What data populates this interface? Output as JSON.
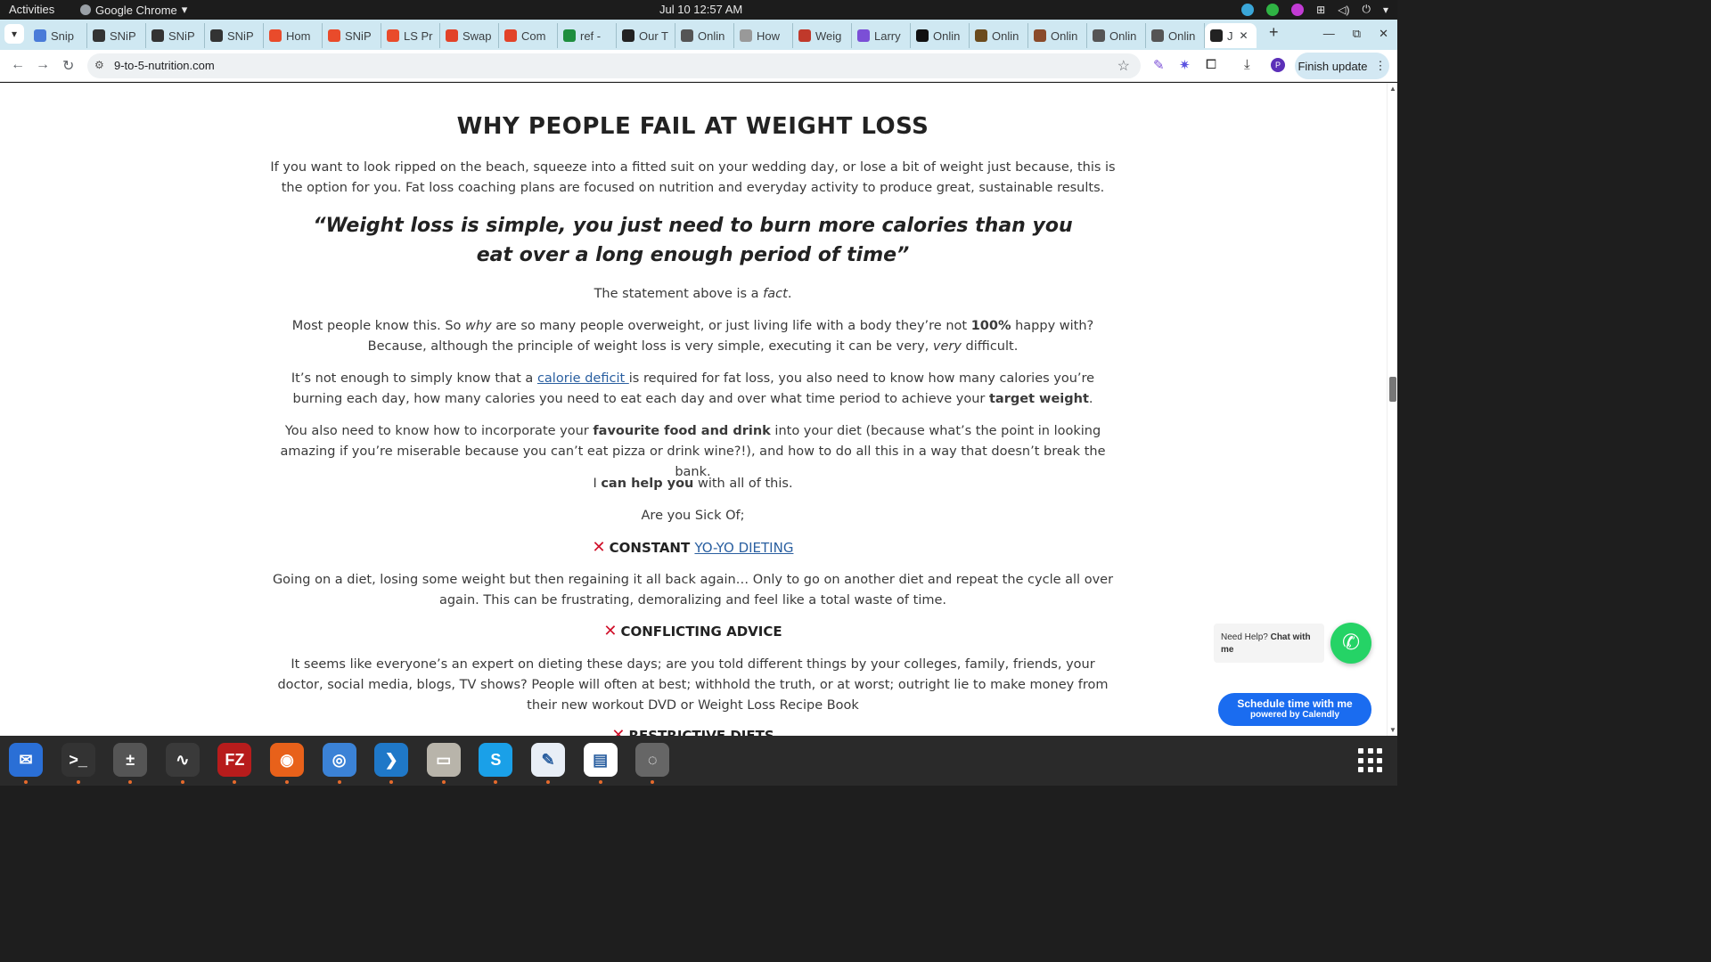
{
  "topbar": {
    "activities": "Activities",
    "app_name": "Google Chrome",
    "clock": "Jul 10  12:57 AM"
  },
  "tabs": [
    {
      "label": "Snip",
      "color": "#4a7bd8"
    },
    {
      "label": "SNiP",
      "color": "#333333"
    },
    {
      "label": "SNiP",
      "color": "#333333"
    },
    {
      "label": "SNiP",
      "color": "#333333"
    },
    {
      "label": "Hom",
      "color": "#e94b2b"
    },
    {
      "label": "SNiP",
      "color": "#e94b2b"
    },
    {
      "label": "LS Pr",
      "color": "#e94b2b"
    },
    {
      "label": "Swap",
      "color": "#e24329"
    },
    {
      "label": "Com",
      "color": "#e24329"
    },
    {
      "label": "ref -",
      "color": "#1e8e3e"
    },
    {
      "label": "Our T",
      "color": "#222222"
    },
    {
      "label": "Onlin",
      "color": "#555555"
    },
    {
      "label": "How",
      "color": "#999999"
    },
    {
      "label": "Weig",
      "color": "#c0392b"
    },
    {
      "label": "Larry",
      "color": "#7b4fd6"
    },
    {
      "label": "Onlin",
      "color": "#111111"
    },
    {
      "label": "Onlin",
      "color": "#6b4b1e"
    },
    {
      "label": "Onlin",
      "color": "#8a4b2b"
    },
    {
      "label": "Onlin",
      "color": "#555555"
    },
    {
      "label": "Onlin",
      "color": "#555555"
    }
  ],
  "active_tab": {
    "label": "J"
  },
  "address": {
    "url": "9-to-5-nutrition.com",
    "profile_initial": "P",
    "finish_update": "Finish update"
  },
  "article": {
    "title": "WHY PEOPLE FAIL AT WEIGHT LOSS",
    "intro": "If you want to look ripped on the beach, squeeze into a fitted suit on your wedding day, or lose a bit of weight just because, this is the option for you. Fat loss coaching plans are focused on nutrition and everyday activity to produce great, sustainable results.",
    "quote": "“Weight loss is simple, you just need to burn more calories than you eat over a long enough period of time”",
    "fact_prefix": "The statement above is a ",
    "fact_word": "fact",
    "fact_suffix": ".",
    "p2_a": "Most people know this. So ",
    "p2_b": "why",
    "p2_c": " are so many people overweight, or just living life with a body they’re not ",
    "p2_d": "100%",
    "p2_e": " happy with? Because, although the principle of weight loss is very simple, executing it can be very, ",
    "p2_f": "very",
    "p2_g": " difficult.",
    "p3_a": "It’s not enough to simply know that a ",
    "p3_link": "calorie deficit ",
    "p3_b": "is required for fat loss, you also need to know how many calories you’re burning each day, how many calories you need to eat each day and over what time period to achieve your ",
    "p3_c": "target weight",
    "p3_d": ".",
    "p4_a": "You also need to know how to incorporate your ",
    "p4_b": "favourite food and drink",
    "p4_c": " into your diet (because what’s the point in looking amazing if you’re miserable because you can’t eat pizza or drink wine?!), and how to do all this in a way that doesn’t break the bank.",
    "p5_a": "I ",
    "p5_b": "can help you",
    "p5_c": " with all of this.",
    "sick_of": "Are you Sick Of;",
    "h_yoyo_a": "CONSTANT ",
    "h_yoyo_link": "YO-YO DIETING",
    "yoyo_text": "Going on a diet, losing some weight but then regaining it all back again… Only to go on another diet and repeat the cycle all over again. This can be frustrating, demoralizing and feel like a total waste of time.",
    "h_conflict": "CONFLICTING ADVICE",
    "conflict_text": "It seems like everyone’s an expert on dieting these days; are you told different things by your colleges, family, friends, your doctor, social media, blogs, TV shows? People will often at best; withhold the truth, or at worst; outright lie to make money from their new workout DVD or Weight Loss Recipe Book",
    "h_restrictive": "RESTRICTIVE DIETS"
  },
  "widgets": {
    "need_help": "Need Help? ",
    "chat_with": "Chat with me",
    "calendly_line1": "Schedule time with me",
    "calendly_line2": "powered by Calendly"
  },
  "colors": {
    "accent_cross": "#d0102a",
    "link": "#2a5fa0",
    "whatsapp": "#25d366",
    "calendly": "#1a6cf0"
  },
  "dock": [
    {
      "name": "thunderbird",
      "color": "#2a6fd6"
    },
    {
      "name": "terminal",
      "color": "#333333"
    },
    {
      "name": "calculator",
      "color": "#555555"
    },
    {
      "name": "system-monitor",
      "color": "#3a3a3a"
    },
    {
      "name": "filezilla",
      "color": "#b71c1c"
    },
    {
      "name": "firefox",
      "color": "#e8611a"
    },
    {
      "name": "chrome",
      "color": "#3b82d6"
    },
    {
      "name": "vscode",
      "color": "#1f78c8"
    },
    {
      "name": "files",
      "color": "#b8b4aa"
    },
    {
      "name": "skype",
      "color": "#1aa0e8"
    },
    {
      "name": "text-editor",
      "color": "#e8eef6"
    },
    {
      "name": "document-viewer",
      "color": "#ffffff"
    },
    {
      "name": "disk-tool",
      "color": "#666666"
    }
  ]
}
